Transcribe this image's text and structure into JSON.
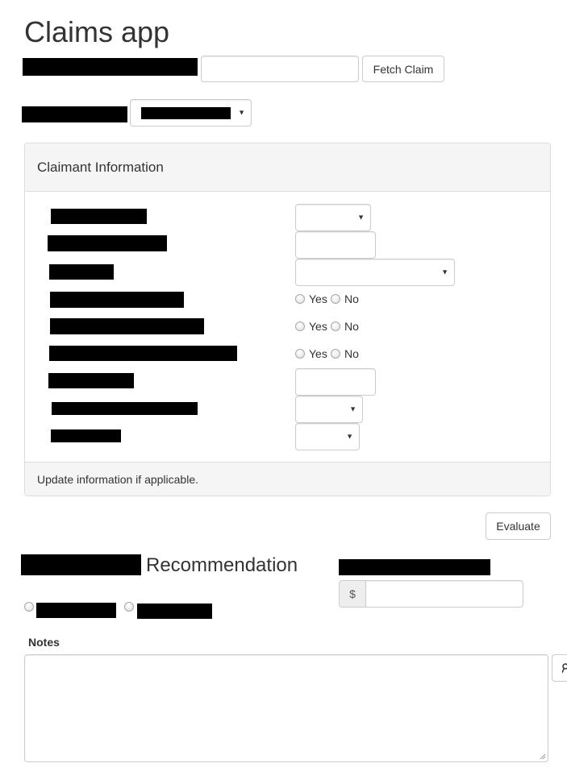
{
  "header": {
    "title": "Claims app"
  },
  "claim_lookup": {
    "input_value": "",
    "fetch_label": "Fetch Claim"
  },
  "claim_type_select": {
    "value": ""
  },
  "claimant_panel": {
    "heading": "Claimant Information",
    "footer": "Update information if applicable.",
    "yes_label": "Yes",
    "no_label": "No"
  },
  "evaluate": {
    "label": "Evaluate"
  },
  "recommendation": {
    "heading": "Recommendation"
  },
  "amount": {
    "currency_symbol": "$",
    "value": ""
  },
  "notes": {
    "label": "Notes",
    "value": ""
  }
}
